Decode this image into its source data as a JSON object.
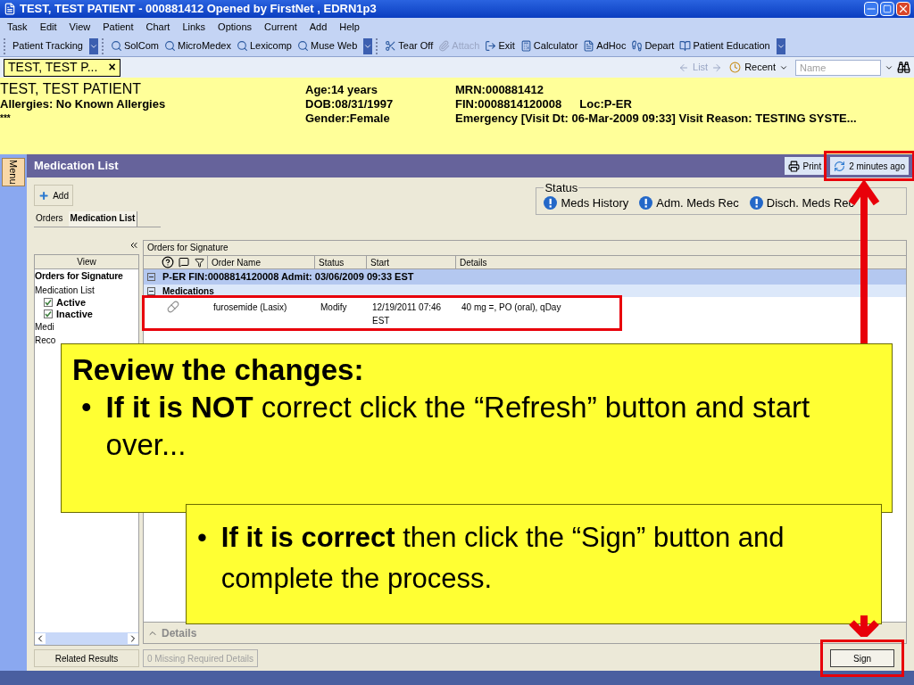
{
  "window": {
    "title": "TEST, TEST PATIENT - 000881412 Opened by FirstNet , EDRN1p3"
  },
  "menu": [
    "Task",
    "Edit",
    "View",
    "Patient",
    "Chart",
    "Links",
    "Options",
    "Current",
    "Add",
    "Help"
  ],
  "toolbars": [
    [
      {
        "label": "Patient Tracking",
        "disabled": false
      }
    ],
    [
      {
        "label": "SolCom",
        "disabled": false
      },
      {
        "label": "MicroMedex",
        "disabled": false
      },
      {
        "label": "Lexicomp",
        "disabled": false
      },
      {
        "label": "Muse Web",
        "disabled": false
      }
    ],
    [
      {
        "label": "Tear Off",
        "disabled": false
      },
      {
        "label": "Attach",
        "disabled": true
      },
      {
        "label": "Exit",
        "disabled": false
      },
      {
        "label": "Calculator",
        "disabled": false
      },
      {
        "label": "AdHoc",
        "disabled": false
      },
      {
        "label": "Depart",
        "disabled": false
      },
      {
        "label": "Patient Education",
        "disabled": false
      }
    ]
  ],
  "patient_tab": {
    "label": "TEST, TEST P...",
    "close": "×"
  },
  "navigation": {
    "list": "List",
    "recent": "Recent",
    "name_placeholder": "Name"
  },
  "banner": {
    "name": "TEST, TEST PATIENT",
    "allergies": "Allergies: No Known Allergies",
    "flag": "***",
    "age": "Age:14 years",
    "dob": "DOB:08/31/1997",
    "gender": "Gender:Female",
    "mrn": "MRN:000881412",
    "fin": "FIN:0008814120008",
    "loc": "Loc:P-ER",
    "visit": "Emergency [Visit Dt: 06-Mar-2009 09:33] Visit Reason: TESTING SYSTE..."
  },
  "side_menu": "Menu",
  "panel": {
    "title": "Medication List",
    "print": "Print",
    "refreshed": "2 minutes ago",
    "add": "Add"
  },
  "tabs": [
    {
      "label": "Orders",
      "selected": false
    },
    {
      "label": "Medication List",
      "selected": true
    }
  ],
  "status": {
    "title": "Status",
    "items": [
      "Meds History",
      "Adm. Meds Rec",
      "Disch. Meds Rec"
    ]
  },
  "view_pane": {
    "header": "View",
    "items": [
      {
        "label": "Orders for Signature",
        "bold": true
      },
      {
        "label": "Medication List",
        "bold": false,
        "children": [
          {
            "label": "Active",
            "checked": true
          },
          {
            "label": "Inactive",
            "checked": true
          }
        ]
      },
      {
        "label": "Medi",
        "bold": false
      },
      {
        "label": "Reco",
        "bold": false
      }
    ],
    "related": "Related Results"
  },
  "grid": {
    "title": "Orders for Signature",
    "columns": [
      "Order Name",
      "Status",
      "Start",
      "Details"
    ],
    "encounter": "P-ER  FIN:0008814120008  Admit: 03/06/2009 09:33 EST",
    "section": "Medications",
    "rows": [
      {
        "name": "furosemide (Lasix)",
        "status": "Modify",
        "start": "12/19/2011 07:46 EST",
        "details": "40 mg =, PO (oral), qDay"
      }
    ]
  },
  "details": "Details",
  "missing": "0 Missing Required Details",
  "sign": "Sign",
  "callouts": [
    {
      "title": "Review the changes:",
      "bullet": "•",
      "text": "**If it is NOT** correct click the “Refresh” button and start over..."
    },
    {
      "bullet": "•",
      "text": "**If it is correct** then click the “Sign” button and complete the process."
    }
  ]
}
